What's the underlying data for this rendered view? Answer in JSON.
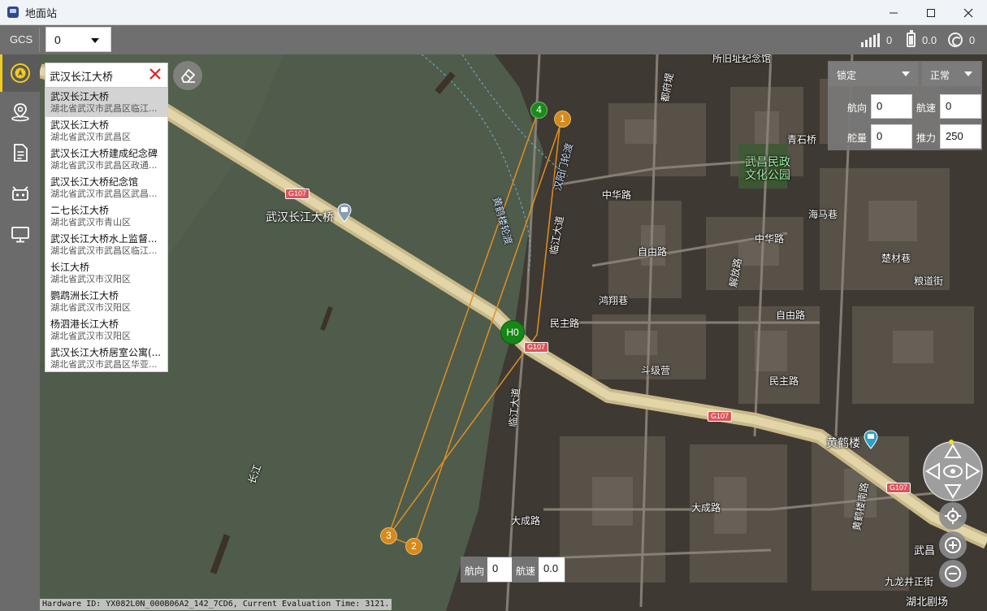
{
  "window": {
    "title": "地面站",
    "minimize": "—",
    "maximize": "☐",
    "close": "✕"
  },
  "toolbar": {
    "gcs_label": "GCS",
    "gcs_value": "0",
    "signal_value": "0",
    "battery_value": "0.0",
    "gps_value": "0"
  },
  "sidebar": {
    "items": [
      {
        "name": "compass",
        "active": true
      },
      {
        "name": "waypoint"
      },
      {
        "name": "document"
      },
      {
        "name": "vehicle"
      },
      {
        "name": "monitor"
      }
    ]
  },
  "search": {
    "value": "武汉长江大桥",
    "clear": "✕",
    "results": [
      {
        "name": "武汉长江大桥",
        "address": "湖北省武汉市武昌区临江..."
      },
      {
        "name": "武汉长江大桥",
        "address": "湖北省武汉市武昌区"
      },
      {
        "name": "武汉长江大桥建成纪念碑",
        "address": "湖北省武汉市武昌区政通..."
      },
      {
        "name": "武汉长江大桥纪念馆",
        "address": "湖北省武汉市武昌区武昌..."
      },
      {
        "name": "二七长江大桥",
        "address": "湖北省武汉市青山区"
      },
      {
        "name": "武汉长江大桥水上监督...",
        "address": "湖北省武汉市武昌区临江..."
      },
      {
        "name": "长江大桥",
        "address": "湖北省武汉市汉阳区"
      },
      {
        "name": "鹦鹉洲长江大桥",
        "address": "湖北省武汉市汉阳区"
      },
      {
        "name": "杨泗港长江大桥",
        "address": "湖北省武汉市汉阳区"
      },
      {
        "name": "武汉长江大桥居室公寓(...",
        "address": "湖北省武汉市武昌区华亚..."
      }
    ]
  },
  "control_panel": {
    "lock_label": "锁定",
    "mode_label": "正常",
    "heading_label": "航向",
    "heading_value": "0",
    "speed_label": "航速",
    "speed_value": "0",
    "rudder_label": "舵量",
    "rudder_value": "0",
    "thrust_label": "推力",
    "thrust_value": "250"
  },
  "bottom_panel": {
    "heading_label": "航向",
    "heading_value": "0",
    "speed_label": "航速",
    "speed_value": "0.0"
  },
  "waypoints": [
    {
      "label": "1",
      "color": "#d68a1a"
    },
    {
      "label": "2",
      "color": "#d68a1a"
    },
    {
      "label": "3",
      "color": "#d68a1a"
    },
    {
      "label": "4",
      "color": "#1a8a1a"
    }
  ],
  "home_label": "H0",
  "map_labels": {
    "bridge": "武汉长江大桥",
    "yangtze": "长江",
    "park": "武昌民政\n文化公园",
    "yellow_crane": "黄鹤楼",
    "zhonghua_rd": "中华路",
    "zhonghua_rd2": "中华路",
    "linjiang_ave": "临江大道",
    "linjiang_ave2": "临江大道",
    "minzhu_rd": "民主路",
    "minzhu_st": "民主路",
    "ziyang_rd": "自由路",
    "ziyang_rd2": "自由路",
    "hongxiang": "鸿翔巷",
    "douji": "斗级营",
    "dacheng_rd": "大成路",
    "dacheng_rd2": "大成路",
    "liangdao": "粮道街",
    "chuchai": "楚材巷",
    "qingshi": "青石桥",
    "haima": "海马巷",
    "jiefang": "解放路",
    "duqu": "都府堤",
    "huanghe_rd": "黄鹤楼南路",
    "suoqiao": "所旧址纪念馆",
    "wuchang": "武昌",
    "jiulong": "九龙井正街",
    "hubei": "湖北剧场",
    "hanyang_ferry": "汉阳门轮渡",
    "huanghe_ferry": "黄鹤楼轮渡",
    "g107": "G107"
  },
  "footer": "Hardware ID: YX082L0N_000B06A2_142_7CD6, Current Evaluation Time: 3121."
}
